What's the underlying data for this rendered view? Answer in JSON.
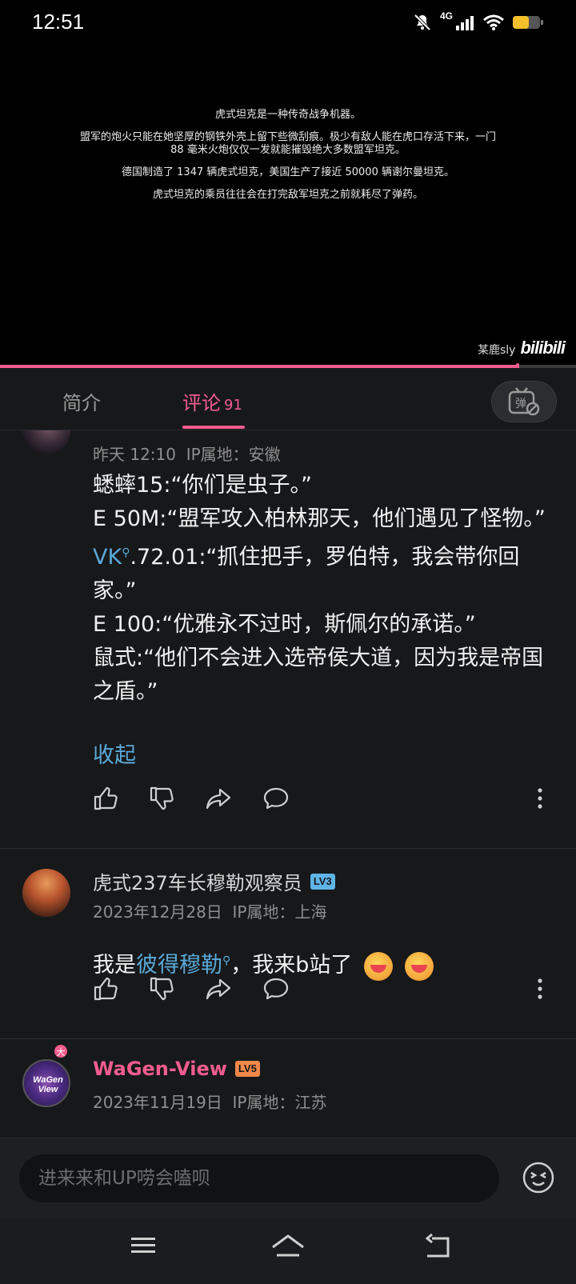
{
  "status": {
    "time": "12:51",
    "network": "4G"
  },
  "video": {
    "subtitles": [
      "虎式坦克是一种传奇战争机器。",
      "盟军的炮火只能在她坚厚的钢铁外壳上留下些微刮痕。极少有敌人能在虎口存活下来，一门 88 毫米火炮仅仅一发就能摧毁绝大多数盟军坦克。",
      "德国制造了 1347 辆虎式坦克，美国生产了接近 50000 辆谢尔曼坦克。",
      "虎式坦克的乘员往往会在打完敌军坦克之前就耗尽了弹药。"
    ],
    "watermark_user": "某鹿sly",
    "watermark_logo": "bilibili",
    "progress_fraction": 0.9
  },
  "tabs": {
    "intro": "简介",
    "comments": "评论",
    "comments_count": "91"
  },
  "comments": [
    {
      "meta_date": "昨天 12:10",
      "meta_ip": "IP属地：安徽",
      "lines": {
        "l1": "蟋蟀15:“你们是虫子。”",
        "l2": "E 50M:“盟军攻入柏林那天，他们遇见了怪物。”",
        "l3_link": "VK",
        "l3_rest": ".72.01:“抓住把手，罗伯特，我会带你回家。”",
        "l4": "E 100:“优雅永不过时，斯佩尔的承诺。”",
        "l5": "鼠式:“他们不会进入选帝侯大道，因为我是帝国之盾。”"
      },
      "collapse": "收起"
    },
    {
      "username": "虎式237车长穆勒观察员",
      "level": "LV3",
      "meta_date": "2023年12月28日",
      "meta_ip": "IP属地：上海",
      "text_before": "我是",
      "link": "彼得穆勒",
      "text_after": "，我来b站了"
    },
    {
      "username": "WaGen-View",
      "level": "LV5",
      "avatar_text": "WaGen View",
      "big_member": "大",
      "meta_date": "2023年11月19日",
      "meta_ip": "IP属地：江苏"
    }
  ],
  "input": {
    "placeholder": "进来来和UP唠会嗑呗"
  }
}
